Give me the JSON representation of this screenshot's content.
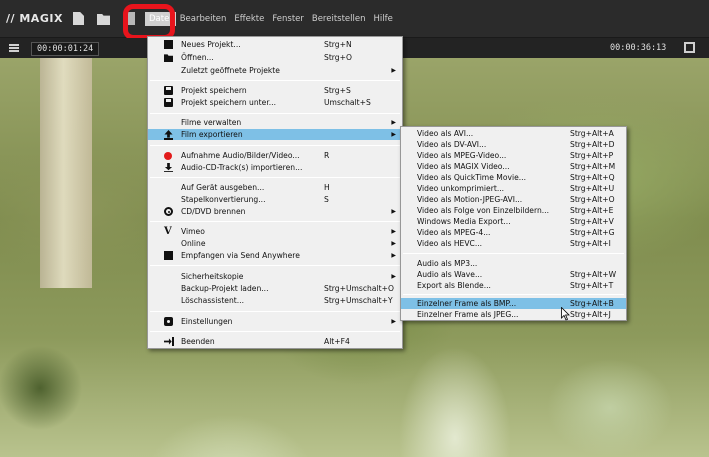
{
  "app": {
    "logo": "// MAGIX",
    "menubar": [
      "Datei",
      "Bearbeiten",
      "Effekte",
      "Fenster",
      "Bereitstellen",
      "Hilfe"
    ]
  },
  "transport": {
    "timecode_left": "00:00:01:24",
    "timecode_right": "00:00:36:13"
  },
  "main_menu": {
    "items": [
      {
        "label": "Neues Projekt...",
        "shortcut": "Strg+N",
        "icon": "new-file-icon"
      },
      {
        "label": "Öffnen...",
        "shortcut": "Strg+O",
        "icon": "folder-icon"
      },
      {
        "label": "Zuletzt geöffnete Projekte",
        "shortcut": "",
        "submenu": true
      },
      {
        "label": "Projekt speichern",
        "shortcut": "Strg+S",
        "icon": "save-icon"
      },
      {
        "label": "Projekt speichern unter...",
        "shortcut": "Umschalt+S",
        "icon": "save-as-icon"
      },
      {
        "label": "Filme verwalten",
        "shortcut": "",
        "submenu": true
      },
      {
        "label": "Film exportieren",
        "shortcut": "",
        "submenu": true,
        "icon": "export-icon",
        "highlighted": true
      },
      {
        "label": "Aufnahme Audio/Bilder/Video...",
        "shortcut": "R",
        "icon": "record-icon"
      },
      {
        "label": "Audio-CD-Track(s) importieren...",
        "shortcut": "",
        "icon": "download-icon"
      },
      {
        "label": "Auf Gerät ausgeben...",
        "shortcut": "H"
      },
      {
        "label": "Stapelkonvertierung...",
        "shortcut": "S"
      },
      {
        "label": "CD/DVD brennen",
        "shortcut": "",
        "submenu": true,
        "icon": "disc-icon"
      },
      {
        "label": "Vimeo",
        "shortcut": "",
        "submenu": true,
        "icon": "vimeo-icon"
      },
      {
        "label": "Online",
        "shortcut": "",
        "submenu": true
      },
      {
        "label": "Empfangen via Send Anywhere",
        "shortcut": "",
        "submenu": true,
        "icon": "send-anywhere-icon"
      },
      {
        "label": "Sicherheitskopie",
        "shortcut": "",
        "submenu": true
      },
      {
        "label": "Backup-Projekt laden...",
        "shortcut": "Strg+Umschalt+O"
      },
      {
        "label": "Löschassistent...",
        "shortcut": "Strg+Umschalt+Y"
      },
      {
        "label": "Einstellungen",
        "shortcut": "",
        "submenu": true,
        "icon": "gear-icon"
      },
      {
        "label": "Beenden",
        "shortcut": "Alt+F4",
        "icon": "exit-icon"
      }
    ]
  },
  "export_menu": {
    "items": [
      {
        "label": "Video als AVI...",
        "shortcut": "Strg+Alt+A"
      },
      {
        "label": "Video als DV-AVI...",
        "shortcut": "Strg+Alt+D"
      },
      {
        "label": "Video als MPEG-Video...",
        "shortcut": "Strg+Alt+P"
      },
      {
        "label": "Video als MAGIX Video...",
        "shortcut": "Strg+Alt+M"
      },
      {
        "label": "Video als QuickTime Movie...",
        "shortcut": "Strg+Alt+Q"
      },
      {
        "label": "Video unkomprimiert...",
        "shortcut": "Strg+Alt+U"
      },
      {
        "label": "Video als Motion-JPEG-AVI...",
        "shortcut": "Strg+Alt+O"
      },
      {
        "label": "Video als Folge von Einzelbildern...",
        "shortcut": "Strg+Alt+E"
      },
      {
        "label": "Windows Media Export...",
        "shortcut": "Strg+Alt+V"
      },
      {
        "label": "Video als MPEG-4...",
        "shortcut": "Strg+Alt+G"
      },
      {
        "label": "Video als HEVC...",
        "shortcut": "Strg+Alt+I"
      },
      {
        "label": "Audio als MP3...",
        "shortcut": ""
      },
      {
        "label": "Audio als Wave...",
        "shortcut": "Strg+Alt+W"
      },
      {
        "label": "Export als Blende...",
        "shortcut": "Strg+Alt+T"
      },
      {
        "label": "Einzelner Frame als BMP...",
        "shortcut": "Strg+Alt+B",
        "highlighted": true
      },
      {
        "label": "Einzelner Frame als JPEG...",
        "shortcut": "Strg+Alt+J"
      }
    ]
  },
  "colors": {
    "highlight": "#7ec0e6",
    "annotation_box": "#e8141c"
  }
}
